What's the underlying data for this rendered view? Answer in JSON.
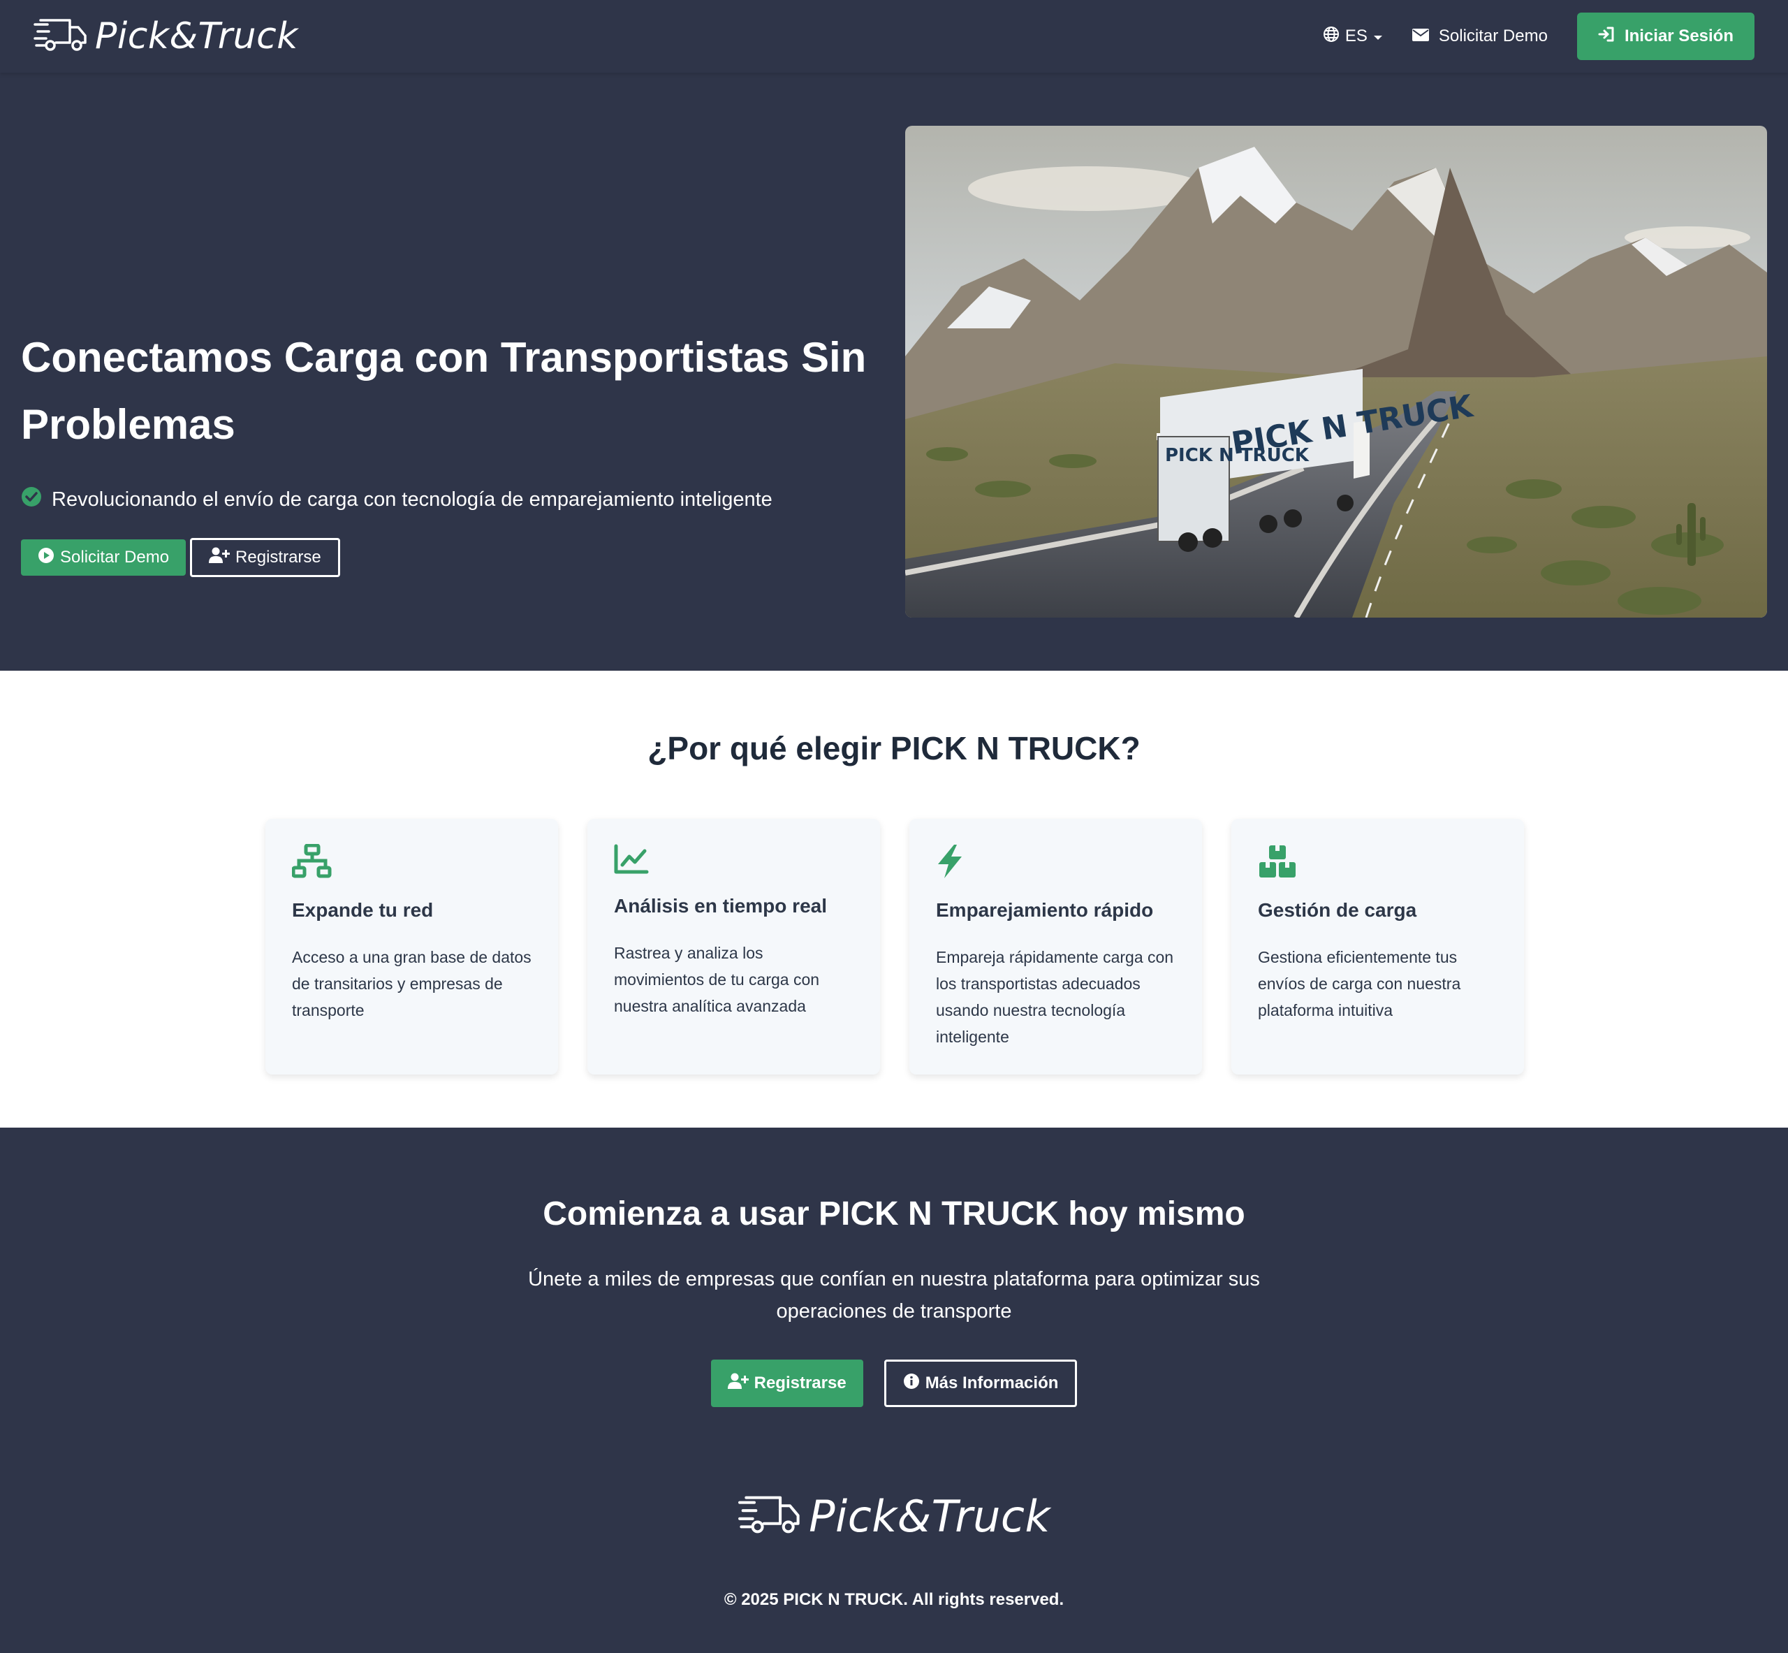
{
  "nav": {
    "brand": "Pick&Truck",
    "language": "ES",
    "demo_link": "Solicitar Demo",
    "login_button": "Iniciar Sesión"
  },
  "hero": {
    "title": "Conectamos Carga con Transportistas Sin Problemas",
    "subtitle": "Revolucionando el envío de carga con tecnología de emparejamiento inteligente",
    "demo_button": "Solicitar Demo",
    "register_button": "Registrarse",
    "truck_text": "PICK N TRUCK"
  },
  "features": {
    "title": "¿Por qué elegir PICK N TRUCK?",
    "cards": [
      {
        "icon": "network-icon",
        "title": "Expande tu red",
        "text": "Acceso a una gran base de datos de transitarios y empresas de transporte"
      },
      {
        "icon": "chart-line-icon",
        "title": "Análisis en tiempo real",
        "text": "Rastrea y analiza los movimientos de tu carga con nuestra analítica avanzada"
      },
      {
        "icon": "bolt-icon",
        "title": "Emparejamiento rápido",
        "text": "Empareja rápidamente carga con los transportistas adecuados usando nuestra tecnología inteligente"
      },
      {
        "icon": "boxes-icon",
        "title": "Gestión de carga",
        "text": "Gestiona eficientemente tus envíos de carga con nuestra plataforma intuitiva"
      }
    ]
  },
  "cta": {
    "title": "Comienza a usar PICK N TRUCK hoy mismo",
    "subtitle": "Únete a miles de empresas que confían en nuestra plataforma para optimizar sus operaciones de transporte",
    "register_button": "Registrarse",
    "info_button": "Más Información"
  },
  "footer": {
    "brand": "Pick&Truck",
    "copyright": "© 2025 PICK N TRUCK. All rights reserved."
  },
  "colors": {
    "background": "#2f3549",
    "accent": "#38a169",
    "card": "#f5f8fb"
  }
}
